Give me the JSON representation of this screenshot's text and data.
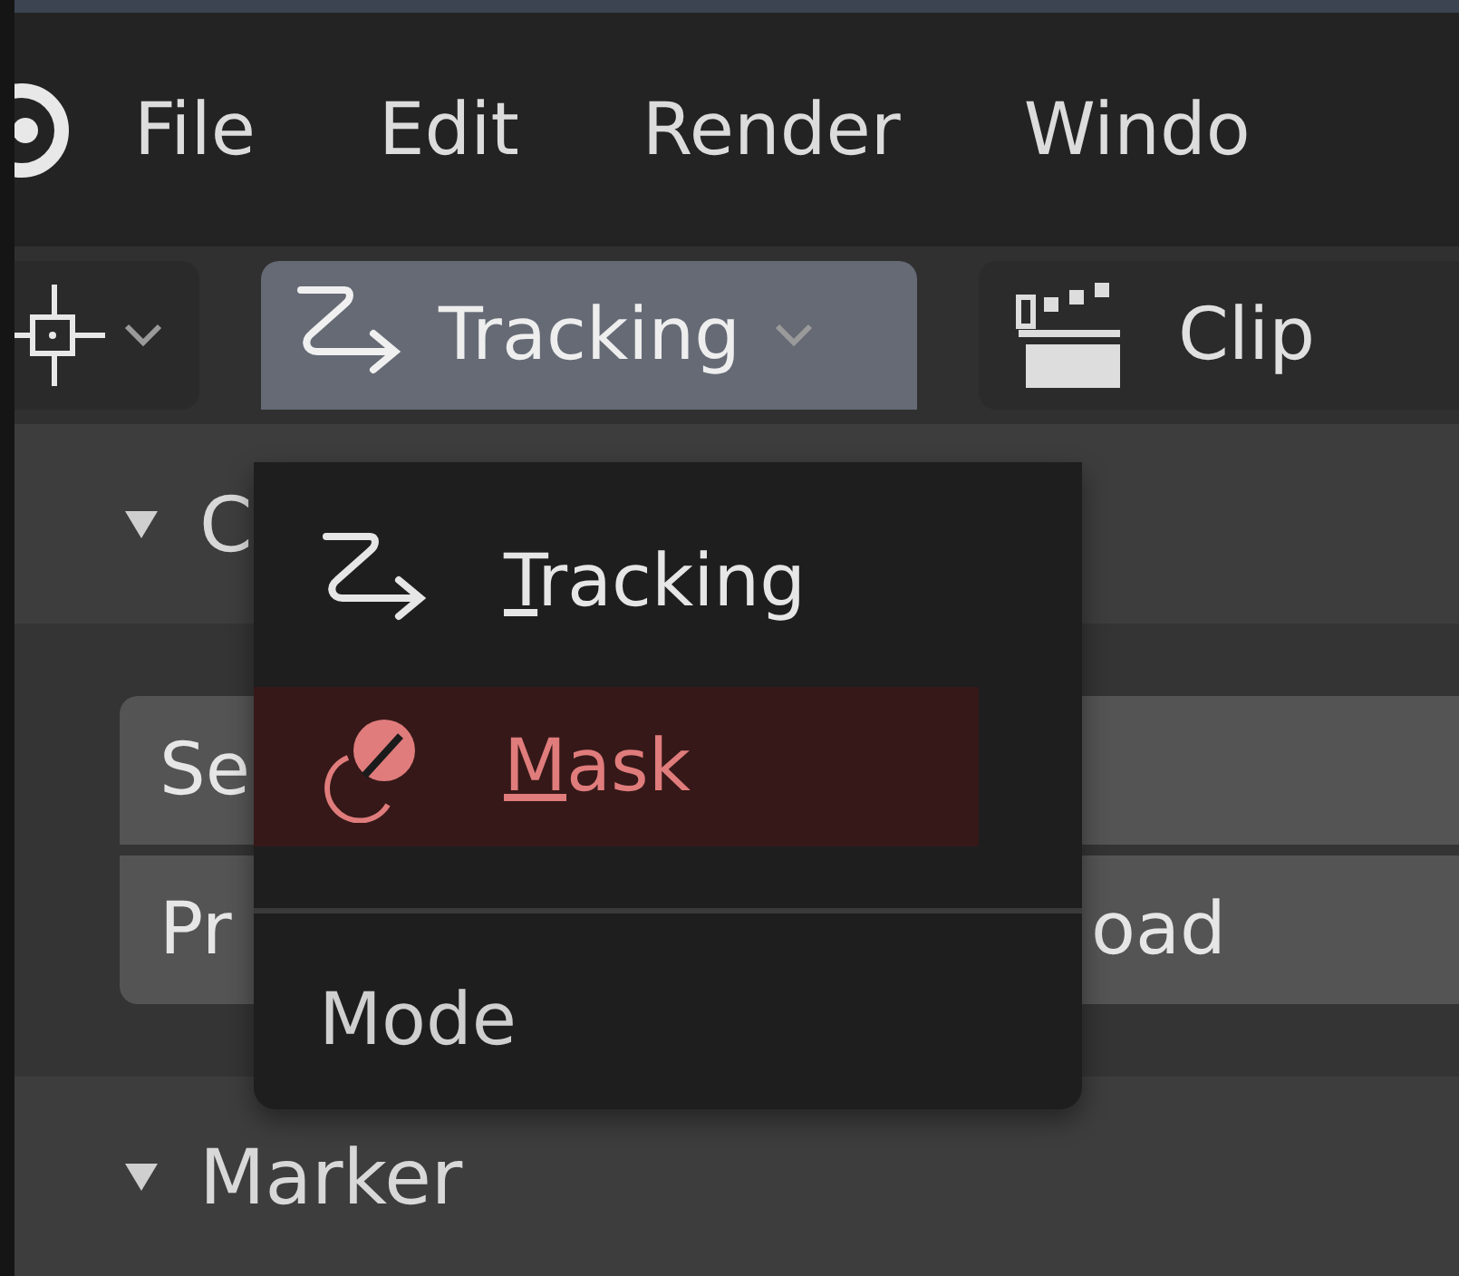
{
  "menubar": {
    "items": [
      "File",
      "Edit",
      "Render",
      "Windo"
    ]
  },
  "header": {
    "mode_menu": {
      "label": "Tracking",
      "open": true
    },
    "clip_button": {
      "label": "Clip"
    }
  },
  "panels": [
    {
      "title": "C",
      "expanded": true,
      "rows": [
        [
          "Se"
        ],
        [
          "Pr",
          "oad"
        ]
      ]
    },
    {
      "title": "Marker",
      "expanded": true
    }
  ],
  "dropdown": {
    "items": [
      {
        "kind": "tracking",
        "label": "Tracking",
        "selected": false
      },
      {
        "kind": "mask",
        "label": "Mask",
        "selected": true
      }
    ],
    "footer": "Mode"
  }
}
